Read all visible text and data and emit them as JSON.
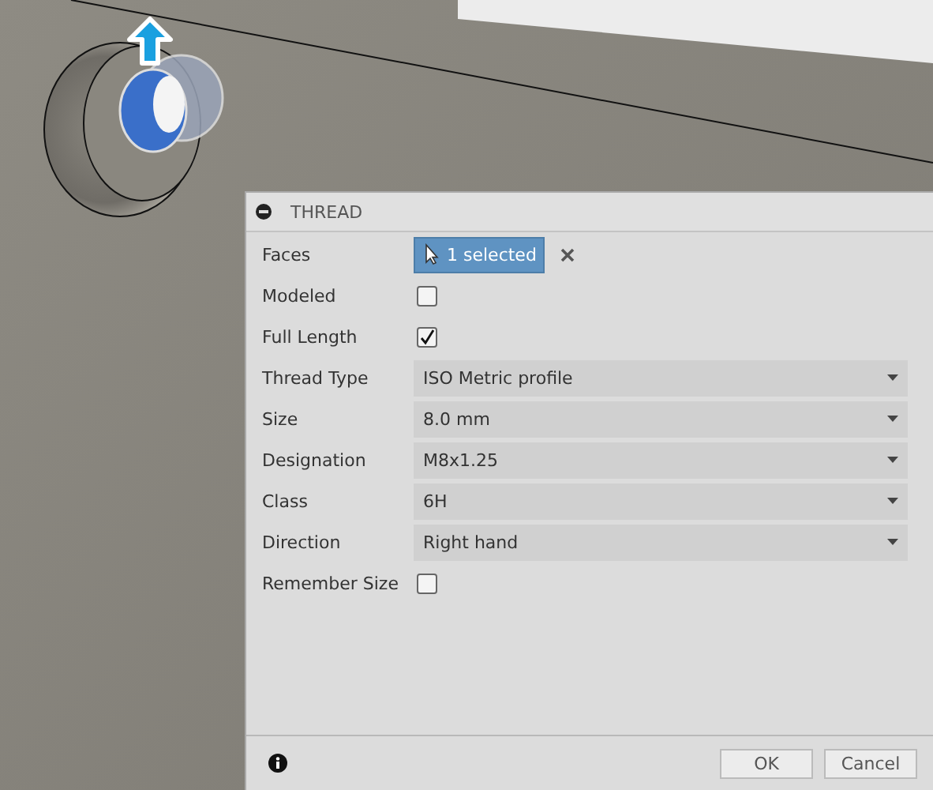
{
  "panel": {
    "title": "THREAD",
    "fields": [
      {
        "label": "Faces",
        "kind": "selection",
        "value": "1 selected"
      },
      {
        "label": "Modeled",
        "kind": "checkbox",
        "checked": false
      },
      {
        "label": "Full Length",
        "kind": "checkbox",
        "checked": true
      },
      {
        "label": "Thread Type",
        "kind": "dropdown",
        "value": "ISO Metric profile"
      },
      {
        "label": "Size",
        "kind": "dropdown",
        "value": "8.0 mm"
      },
      {
        "label": "Designation",
        "kind": "dropdown",
        "value": "M8x1.25"
      },
      {
        "label": "Class",
        "kind": "dropdown",
        "value": "6H"
      },
      {
        "label": "Direction",
        "kind": "dropdown",
        "value": "Right hand"
      },
      {
        "label": "Remember Size",
        "kind": "checkbox",
        "checked": false
      }
    ],
    "buttons": [
      "OK",
      "Cancel"
    ]
  }
}
